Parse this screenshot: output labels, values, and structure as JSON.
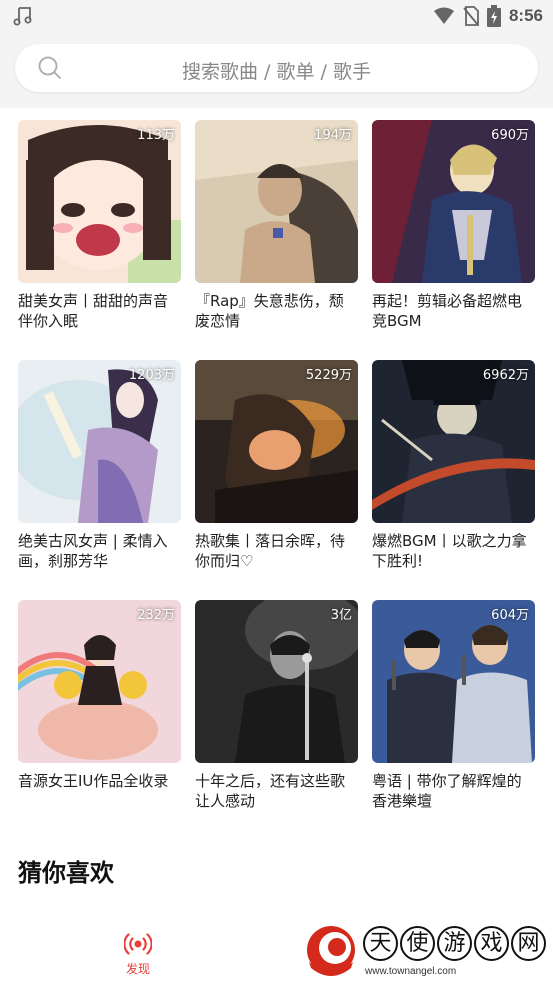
{
  "status_bar": {
    "time": "8:56",
    "icons": [
      "music-note-icon",
      "wifi-icon",
      "no-sim-icon",
      "battery-charging-icon"
    ]
  },
  "search": {
    "placeholder": "搜索歌曲 / 歌单 / 歌手"
  },
  "playlists": [
    {
      "title": "甜美女声丨甜甜的声音伴你入眠",
      "plays": "113万",
      "cover": "anime-girl",
      "colors": [
        "#f7e6d8",
        "#3b2a25",
        "#c9e0a9"
      ]
    },
    {
      "title": "『Rap』失意悲伤，颓废恋情",
      "plays": "194万",
      "cover": "sketch-man",
      "colors": [
        "#e9ddc8",
        "#4a4038",
        "#8a7b6c"
      ]
    },
    {
      "title": "再起！剪辑必备超燃电竞BGM",
      "plays": "690万",
      "cover": "knight",
      "colors": [
        "#3a2a4a",
        "#d8c27a",
        "#8f6fb0"
      ]
    },
    {
      "title": "绝美古风女声 | 柔情入画，刹那芳华",
      "plays": "1203万",
      "cover": "ancient-lady",
      "colors": [
        "#e9eef2",
        "#6c5aa8",
        "#b49ac9"
      ]
    },
    {
      "title": "热歌集丨落日余晖，待你而归♡",
      "plays": "5229万",
      "cover": "sunset-girl",
      "colors": [
        "#2b2320",
        "#f29a3a",
        "#8a5a30"
      ]
    },
    {
      "title": "爆燃BGM丨以歌之力拿下胜利!",
      "plays": "6962万",
      "cover": "dark-warrior",
      "colors": [
        "#1e2430",
        "#d8d2c0",
        "#c34a2a"
      ]
    },
    {
      "title": "音源女王IU作品全收录",
      "plays": "232万",
      "cover": "iu-strawberry",
      "colors": [
        "#f1d6dc",
        "#f0b8a8",
        "#f2c53a"
      ]
    },
    {
      "title": "十年之后，还有这些歌让人感动",
      "plays": "3亿",
      "cover": "singer-mono",
      "colors": [
        "#2a2a2a",
        "#9a9a9a",
        "#e0e0e0"
      ]
    },
    {
      "title": "粤语 | 带你了解辉煌的香港樂壇",
      "plays": "604万",
      "cover": "concert-duo",
      "colors": [
        "#3a5a9a",
        "#c8d0e0",
        "#2a3040"
      ]
    }
  ],
  "section": {
    "title": "猜你喜欢"
  },
  "bottom_nav": {
    "discover_label": "发现",
    "accent": "#e8403a"
  },
  "watermark": {
    "chars": [
      "天",
      "使",
      "游",
      "戏",
      "网"
    ],
    "url": "www.townangel.com"
  }
}
